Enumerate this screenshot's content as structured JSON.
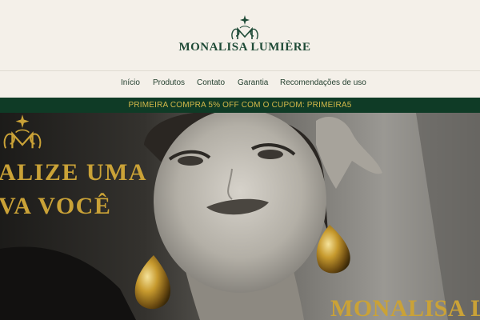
{
  "header": {
    "brand_name": "MONALISA LUMIÈRE",
    "logo_icon": "monogram-m-star-icon"
  },
  "nav": {
    "items": [
      {
        "label": "Início"
      },
      {
        "label": "Produtos"
      },
      {
        "label": "Contato"
      },
      {
        "label": "Garantia"
      },
      {
        "label": "Recomendações de uso"
      }
    ]
  },
  "promo": {
    "text": "PRIMEIRA COMPRA 5% OFF COM O CUPOM: PRIMEIRA5"
  },
  "hero": {
    "headline_line1": "ALIZE UMA",
    "headline_line2": "VA VOCÊ",
    "brand_overlay": "MONALISA LU"
  },
  "colors": {
    "background": "#f4f0e9",
    "brand_green": "#1e4a36",
    "promo_bar": "#0f3b26",
    "gold": "#caa237"
  }
}
